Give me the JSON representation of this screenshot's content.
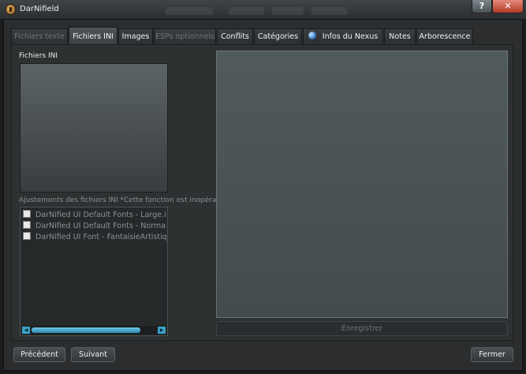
{
  "window": {
    "title": "DarNifield"
  },
  "tabs": [
    {
      "label": "Fichiers texte",
      "state": "disabled"
    },
    {
      "label": "Fichiers INI",
      "state": "active"
    },
    {
      "label": "Images",
      "state": "normal"
    },
    {
      "label": "ESPs optionnels",
      "state": "disabled"
    },
    {
      "label": "Conflits",
      "state": "normal"
    },
    {
      "label": "Catégories",
      "state": "normal"
    },
    {
      "label": "Infos du Nexus",
      "state": "normal",
      "icon": "globe-icon"
    },
    {
      "label": "Notes",
      "state": "normal"
    },
    {
      "label": "Arborescence",
      "state": "normal"
    }
  ],
  "ini_files": {
    "label": "Fichiers INI"
  },
  "adjustments": {
    "label": "Ajustements des fichiers INI *Cette fonction est inopérante.*",
    "items": [
      {
        "label": "DarNified UI Default Fonts - Large.ini",
        "checked": false
      },
      {
        "label": "DarNified UI Default Fonts - Normal.ini",
        "checked": false
      },
      {
        "label": "DarNified UI Font - FantaisieArtistique_",
        "checked": false
      }
    ]
  },
  "editor": {
    "save_label": "Enregistrer"
  },
  "footer": {
    "previous_label": "Précédent",
    "next_label": "Suivant",
    "close_label": "Fermer"
  },
  "colors": {
    "accent": "#3ba4c8",
    "close": "#c8442e"
  }
}
